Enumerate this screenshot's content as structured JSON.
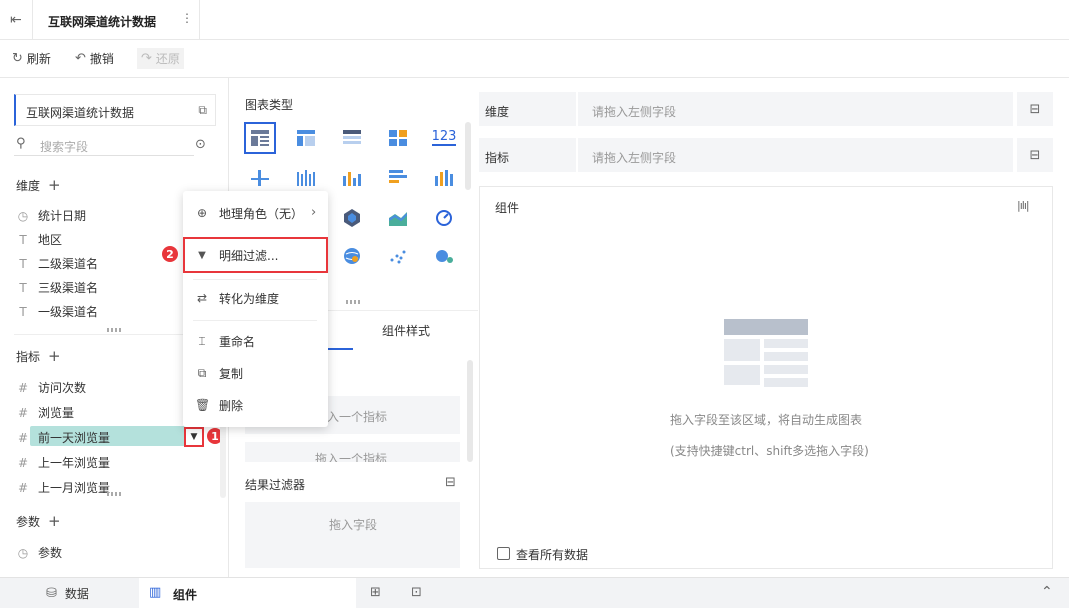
{
  "app": {
    "title": "互联网渠道统计数据"
  },
  "toolbar": {
    "refresh": "刷新",
    "undo": "撤销",
    "redo": "还原"
  },
  "left": {
    "dataset": "互联网渠道统计数据",
    "search_placeholder": "搜索字段",
    "dimensions_title": "维度",
    "dimensions": [
      "统计日期",
      "地区",
      "二级渠道名",
      "三级渠道名",
      "一级渠道名"
    ],
    "measures_title": "指标",
    "measures": [
      "访问次数",
      "浏览量",
      "前一天浏览量",
      "上一年浏览量",
      "上一月浏览量"
    ],
    "params_title": "参数",
    "params": [
      "参数"
    ]
  },
  "middle": {
    "chart_types_title": "图表类型",
    "tab_style": "组件样式",
    "drop_measure_hint": "拖入一个指标",
    "drop_measure_hint2": "拖入一个指标",
    "result_filter_title": "结果过滤器",
    "result_filter_drop": "拖入字段"
  },
  "right": {
    "dimension_label": "维度",
    "dimension_placeholder": "请拖入左侧字段",
    "measure_label": "指标",
    "measure_placeholder": "请拖入左侧字段",
    "component_title": "组件",
    "empty_hint1": "拖入字段至该区域，将自动生成图表",
    "empty_hint2": "(支持快捷键ctrl、shift多选拖入字段)",
    "view_all_label": "查看所有数据"
  },
  "context_menu": {
    "geo_role": "地理角色（无）",
    "detail_filter": "明细过滤...",
    "to_dimension": "转化为维度",
    "rename": "重命名",
    "copy": "复制",
    "delete": "删除"
  },
  "annotations": {
    "badge1": "1",
    "badge2": "2"
  },
  "footer": {
    "data_tab": "数据",
    "component_tab": "组件"
  },
  "colors": {
    "accent": "#2b63d9",
    "selected_field": "#b4e1dc",
    "badge": "#e8363b"
  },
  "chart_type_row1_label": "123"
}
